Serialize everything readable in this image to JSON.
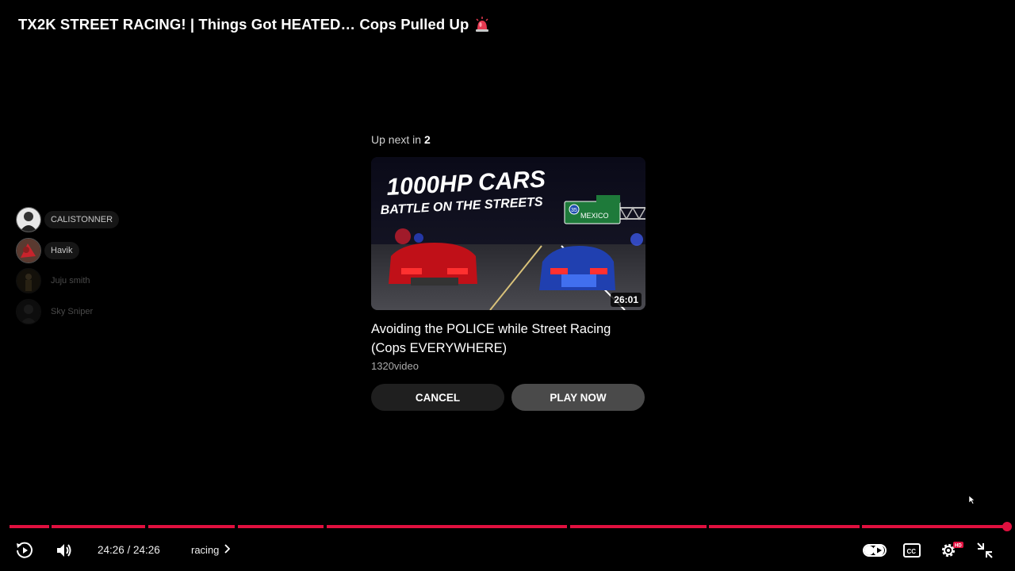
{
  "video": {
    "title": "TX2K STREET RACING! | Things Got HEATED… Cops Pulled Up",
    "title_emoji_icon": "police-siren-icon"
  },
  "chatters": [
    {
      "name": "CALISTONNER",
      "avatar": "avatar-person-icon"
    },
    {
      "name": "Havik",
      "avatar": "avatar-red-icon"
    },
    {
      "name": "Juju smith",
      "avatar": "avatar-figure-icon"
    },
    {
      "name": "Sky Sniper",
      "avatar": "avatar-dark-icon"
    }
  ],
  "up_next": {
    "label_prefix": "Up next in",
    "countdown": "2",
    "thumbnail_text_line1": "1000HP CARS",
    "thumbnail_text_line2": "BATTLE ON THE STREETS",
    "thumbnail_sign_text": "MEXICO",
    "thumbnail_sign_route": "35",
    "duration": "26:01",
    "title": "Avoiding the POLICE while Street Racing (Cops EVERYWHERE)",
    "channel": "1320video",
    "cancel_label": "CANCEL",
    "play_label": "PLAY NOW"
  },
  "player": {
    "current_time": "24:26",
    "total_time": "24:26",
    "time_display": "24:26 / 24:26",
    "chapter": "racing",
    "progress_fraction": 1.0,
    "quality_badge": "HD",
    "accent_color": "#e0103f"
  },
  "icons": {
    "replay": "replay-icon",
    "volume": "volume-icon",
    "autoplay": "autoplay-toggle-icon",
    "captions": "captions-icon",
    "settings": "settings-gear-icon",
    "exit_fullscreen": "exit-fullscreen-icon"
  }
}
